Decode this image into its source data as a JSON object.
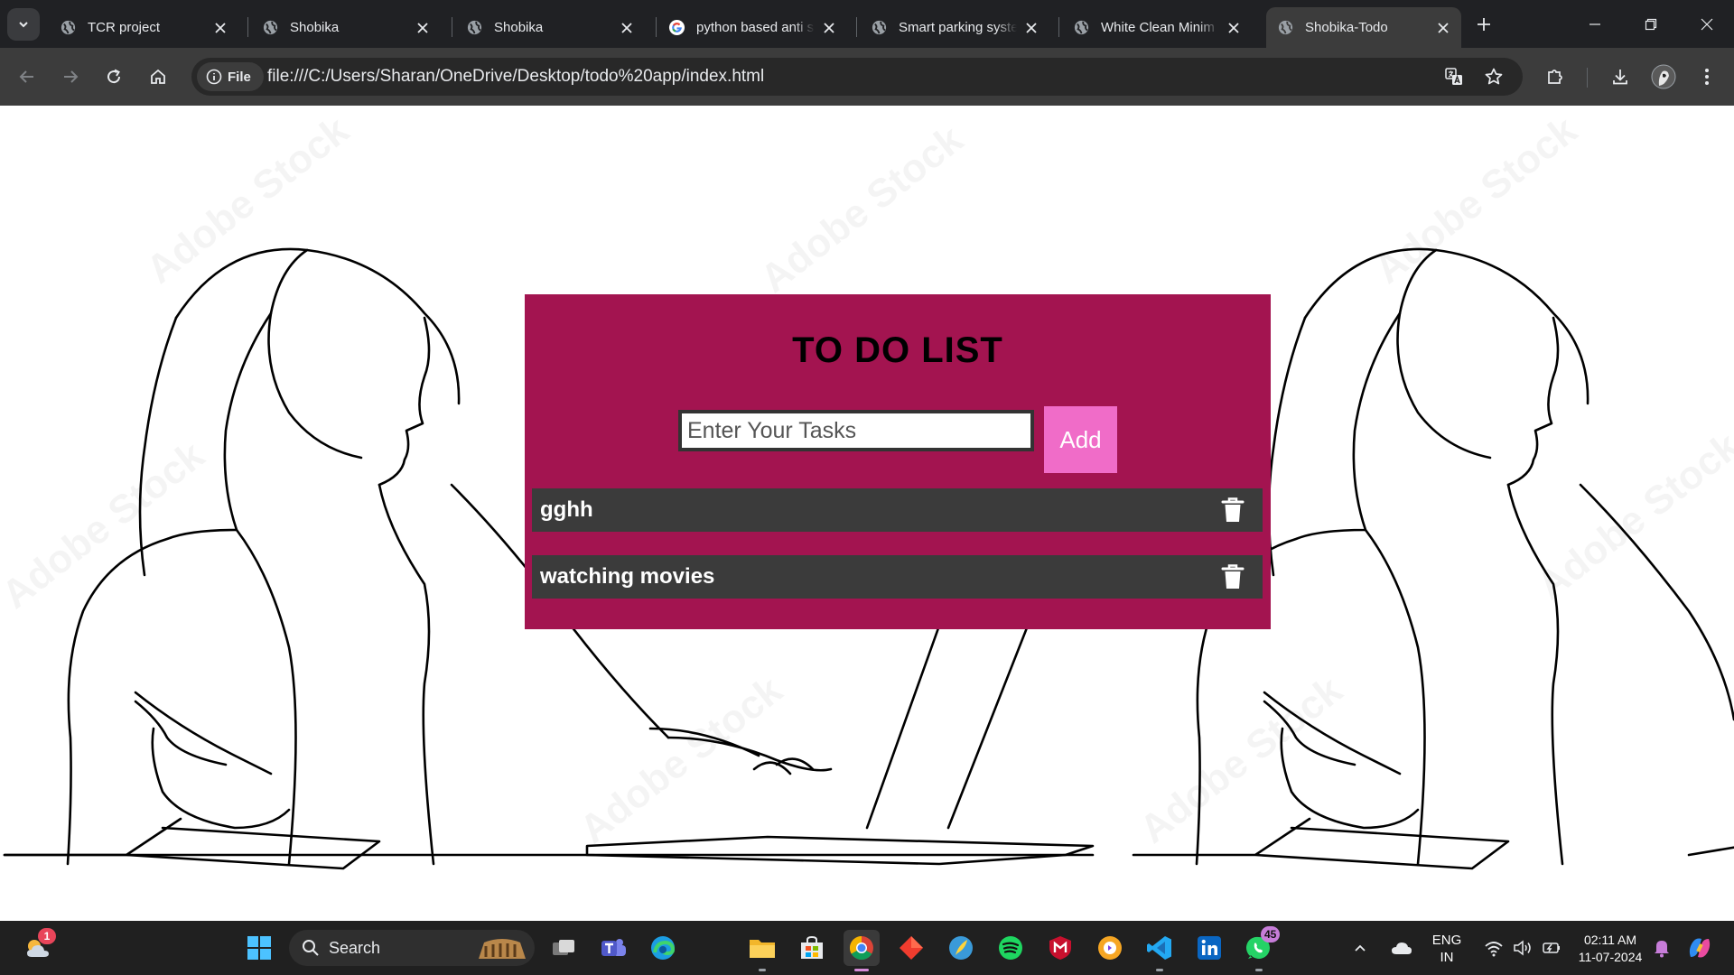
{
  "browser": {
    "tabs": [
      {
        "title": "TCR project",
        "favicon": "globe-icon",
        "active": false
      },
      {
        "title": "Shobika",
        "favicon": "globe-icon",
        "active": false
      },
      {
        "title": "Shobika",
        "favicon": "globe-icon",
        "active": false
      },
      {
        "title": "python based anti s",
        "favicon": "google-icon",
        "active": false
      },
      {
        "title": "Smart parking syste",
        "favicon": "globe-icon",
        "active": false
      },
      {
        "title": "White Clean Minim",
        "favicon": "globe-icon",
        "active": false
      },
      {
        "title": "Shobika-Todo",
        "favicon": "globe-icon",
        "active": true
      }
    ],
    "site_chip_label": "File",
    "url": "file:///C:/Users/Sharan/OneDrive/Desktop/todo%20app/index.html"
  },
  "watermark_text": "Adobe Stock",
  "todo": {
    "title": "TO DO LIST",
    "input_placeholder": "Enter Your Tasks",
    "input_value": "",
    "add_label": "Add",
    "tasks": [
      {
        "text": "gghh"
      },
      {
        "text": "watching movies"
      }
    ]
  },
  "taskbar": {
    "weather_badge": "1",
    "search_placeholder": "Search",
    "whatsapp_badge": "45",
    "language": "ENG",
    "region": "IN",
    "time": "02:11 AM",
    "date": "11-07-2024"
  },
  "colors": {
    "card_background": "#a31450",
    "add_button": "#f06cc8",
    "task_background": "#3b3b3b",
    "tabstrip": "#202124",
    "toolbar": "#3c3c3c"
  }
}
